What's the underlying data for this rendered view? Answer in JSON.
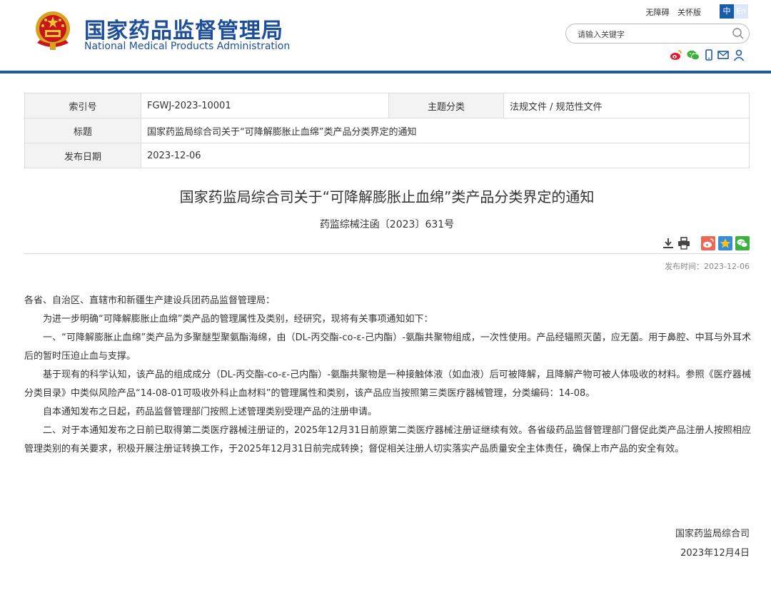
{
  "header": {
    "cn_name": "国家药品监督管理局",
    "en_name": "National Medical Products Administration",
    "toplinks": [
      "无障碍",
      "关怀版"
    ],
    "lang_zh": "中",
    "lang_en": "En",
    "search_placeholder": "请输入关键字",
    "social_icons": [
      "weibo-icon",
      "wechat-icon",
      "mobile-icon",
      "mail-icon",
      "user-icon"
    ],
    "brand_color": "#1d4e9a",
    "accent_color": "#1d58a8"
  },
  "info": {
    "index_label": "索引号",
    "index_value": "FGWJ-2023-10001",
    "category_label": "主题分类",
    "category_value": "法规文件 / 规范性文件",
    "title_label": "标题",
    "title_value": "国家药监局综合司关于“可降解膨胀止血绵”类产品分类界定的通知",
    "date_label": "发布日期",
    "date_value": "2023-12-06"
  },
  "doc": {
    "title": "国家药监局综合司关于“可降解膨胀止血绵”类产品分类界定的通知",
    "number": "药监综械注函〔2023〕631号",
    "publish_time": "发布时间：2023-12-06",
    "tool_icons": [
      "download-icon",
      "print-icon",
      "share-weibo-icon",
      "share-qzone-icon",
      "share-wechat-icon"
    ],
    "salutation": "各省、自治区、直辖市和新疆生产建设兵团药品监督管理局：",
    "paragraphs": [
      "为进一步明确“可降解膨胀止血绵”类产品的管理属性及类别，经研究，现将有关事项通知如下：",
      "一、“可降解膨胀止血绵”类产品为多聚醚型聚氨酯海绵，由（DL-丙交酯-co-ε-己内酯）-氨酯共聚物组成，一次性使用。产品经辐照灭菌，应无菌。用于鼻腔、中耳与外耳术后的暂时压迫止血与支撑。",
      "基于现有的科学认知，该产品的组成成分（DL-丙交酯-co-ε-己内酯）-氨酯共聚物是一种接触体液（如血液）后可被降解，且降解产物可被人体吸收的材料。参照《医疗器械分类目录》中类似风险产品“14-08-01可吸收外科止血材料”的管理属性和类别，该产品应当按照第三类医疗器械管理，分类编码：14-08。",
      "自本通知发布之日起，药品监督管理部门按照上述管理类别受理产品的注册申请。",
      "二、对于本通知发布之日前已取得第二类医疗器械注册证的，2025年12月31日前原第二类医疗器械注册证继续有效。各省级药品监督管理部门督促此类产品注册人按照相应管理类别的有关要求，积极开展注册证转换工作，于2025年12月31日前完成转换；督促相关注册人切实落实产品质量安全主体责任，确保上市产品的安全有效。"
    ],
    "signer": "国家药监局综合司",
    "sign_date": "2023年12月4日"
  }
}
